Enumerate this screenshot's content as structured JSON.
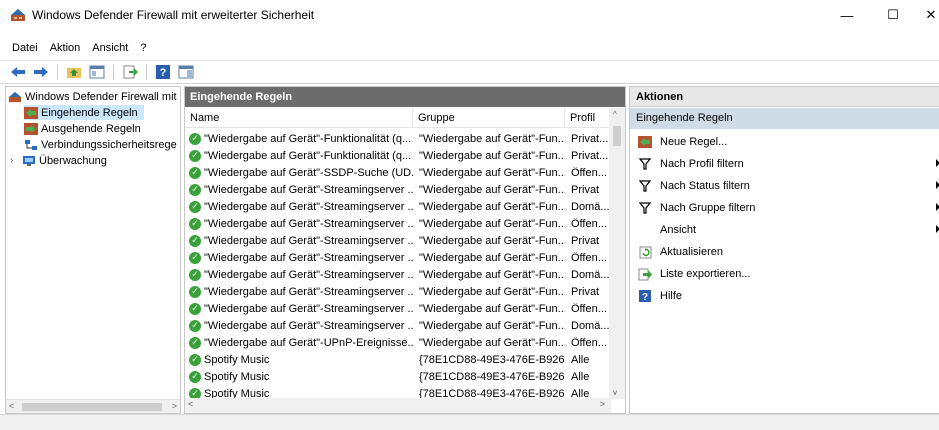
{
  "window": {
    "title": "Windows Defender Firewall mit erweiterter Sicherheit",
    "minimize": "—",
    "maximize": "☐",
    "close": "✕"
  },
  "menu": [
    "Datei",
    "Aktion",
    "Ansicht",
    "?"
  ],
  "tree": {
    "root": "Windows Defender Firewall mit",
    "items": [
      "Eingehende Regeln",
      "Ausgehende Regeln",
      "Verbindungssicherheitsrege",
      "Überwachung"
    ]
  },
  "list": {
    "header": "Eingehende Regeln",
    "columns": [
      "Name",
      "Gruppe",
      "Profil"
    ],
    "rows": [
      {
        "name": "\"Wiedergabe auf Gerät\"-Funktionalität (q...",
        "group": "\"Wiedergabe auf Gerät\"-Fun...",
        "profile": "Privat..."
      },
      {
        "name": "\"Wiedergabe auf Gerät\"-Funktionalität (q...",
        "group": "\"Wiedergabe auf Gerät\"-Fun...",
        "profile": "Privat..."
      },
      {
        "name": "\"Wiedergabe auf Gerät\"-SSDP-Suche (UD...",
        "group": "\"Wiedergabe auf Gerät\"-Fun...",
        "profile": "Öffen..."
      },
      {
        "name": "\"Wiedergabe auf Gerät\"-Streamingserver ...",
        "group": "\"Wiedergabe auf Gerät\"-Fun...",
        "profile": "Privat"
      },
      {
        "name": "\"Wiedergabe auf Gerät\"-Streamingserver ...",
        "group": "\"Wiedergabe auf Gerät\"-Fun...",
        "profile": "Domä..."
      },
      {
        "name": "\"Wiedergabe auf Gerät\"-Streamingserver ...",
        "group": "\"Wiedergabe auf Gerät\"-Fun...",
        "profile": "Öffen..."
      },
      {
        "name": "\"Wiedergabe auf Gerät\"-Streamingserver ...",
        "group": "\"Wiedergabe auf Gerät\"-Fun...",
        "profile": "Privat"
      },
      {
        "name": "\"Wiedergabe auf Gerät\"-Streamingserver ...",
        "group": "\"Wiedergabe auf Gerät\"-Fun...",
        "profile": "Öffen..."
      },
      {
        "name": "\"Wiedergabe auf Gerät\"-Streamingserver ...",
        "group": "\"Wiedergabe auf Gerät\"-Fun...",
        "profile": "Domä..."
      },
      {
        "name": "\"Wiedergabe auf Gerät\"-Streamingserver ...",
        "group": "\"Wiedergabe auf Gerät\"-Fun...",
        "profile": "Privat"
      },
      {
        "name": "\"Wiedergabe auf Gerät\"-Streamingserver ...",
        "group": "\"Wiedergabe auf Gerät\"-Fun...",
        "profile": "Öffen..."
      },
      {
        "name": "\"Wiedergabe auf Gerät\"-Streamingserver ...",
        "group": "\"Wiedergabe auf Gerät\"-Fun...",
        "profile": "Domä..."
      },
      {
        "name": "\"Wiedergabe auf Gerät\"-UPnP-Ereignisse...",
        "group": "\"Wiedergabe auf Gerät\"-Fun...",
        "profile": "Öffen..."
      },
      {
        "name": "Spotify Music",
        "group": "{78E1CD88-49E3-476E-B926-...",
        "profile": "Alle"
      },
      {
        "name": "Spotify Music",
        "group": "{78E1CD88-49E3-476E-B926-...",
        "profile": "Alle"
      },
      {
        "name": "Spotify Music",
        "group": "{78E1CD88-49E3-476E-B926-...",
        "profile": "Alle"
      }
    ]
  },
  "actions": {
    "title": "Aktionen",
    "section": "Eingehende Regeln",
    "items": [
      {
        "label": "Neue Regel...",
        "icon": "new-rule-icon"
      },
      {
        "label": "Nach Profil filtern",
        "icon": "filter-icon"
      },
      {
        "label": "Nach Status filtern",
        "icon": "filter-icon"
      },
      {
        "label": "Nach Gruppe filtern",
        "icon": "filter-icon"
      },
      {
        "label": "Ansicht",
        "icon": ""
      },
      {
        "label": "Aktualisieren",
        "icon": "refresh-icon"
      },
      {
        "label": "Liste exportieren...",
        "icon": "export-icon"
      },
      {
        "label": "Hilfe",
        "icon": "help-icon"
      }
    ]
  },
  "colors": {
    "list_header_bg": "#6c6c6c",
    "selection": "#cce8ff",
    "actions_section": "#cfdce8",
    "enabled_check": "#3aa13a"
  }
}
